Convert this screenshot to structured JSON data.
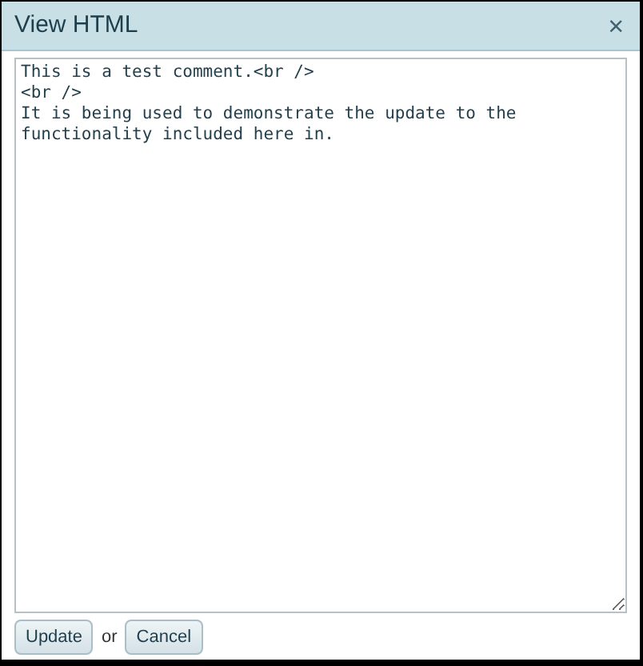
{
  "window": {
    "title": "View HTML",
    "close": "×"
  },
  "editor": {
    "value": "This is a test comment.<br />\n<br />\nIt is being used to demonstrate the update to the\nfunctionality included here in."
  },
  "footer": {
    "buttons": [
      "Update",
      "Cancel"
    ],
    "separator": "or"
  }
}
